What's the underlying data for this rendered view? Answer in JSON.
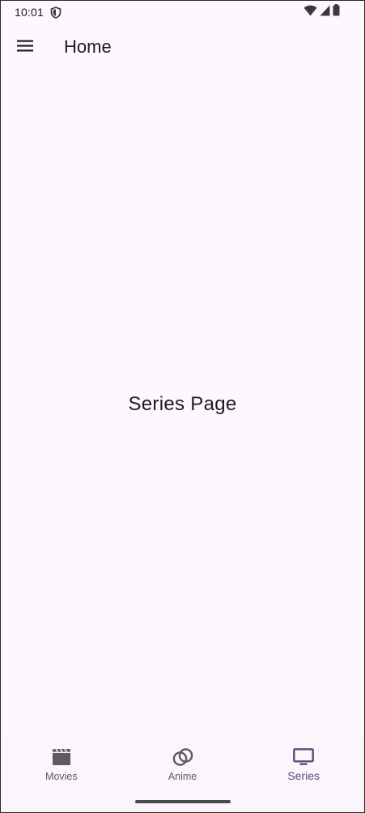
{
  "status_bar": {
    "time": "10:01",
    "icons": [
      "shield-icon",
      "wifi-icon",
      "signal-icon",
      "battery-icon"
    ]
  },
  "app_bar": {
    "menu_icon": "menu-icon",
    "title": "Home"
  },
  "main": {
    "label": "Series Page"
  },
  "bottom_nav": {
    "items": [
      {
        "label": "Movies",
        "icon": "clapperboard-icon",
        "active": false
      },
      {
        "label": "Anime",
        "icon": "rings-icon",
        "active": false
      },
      {
        "label": "Series",
        "icon": "tv-icon",
        "active": true
      }
    ]
  },
  "colors": {
    "background": "#fdf7fe",
    "nav_background": "#fbf5fc",
    "active": "#5b4d7e",
    "inactive_icon": "#5e5a63",
    "text": "#1d1b20"
  }
}
